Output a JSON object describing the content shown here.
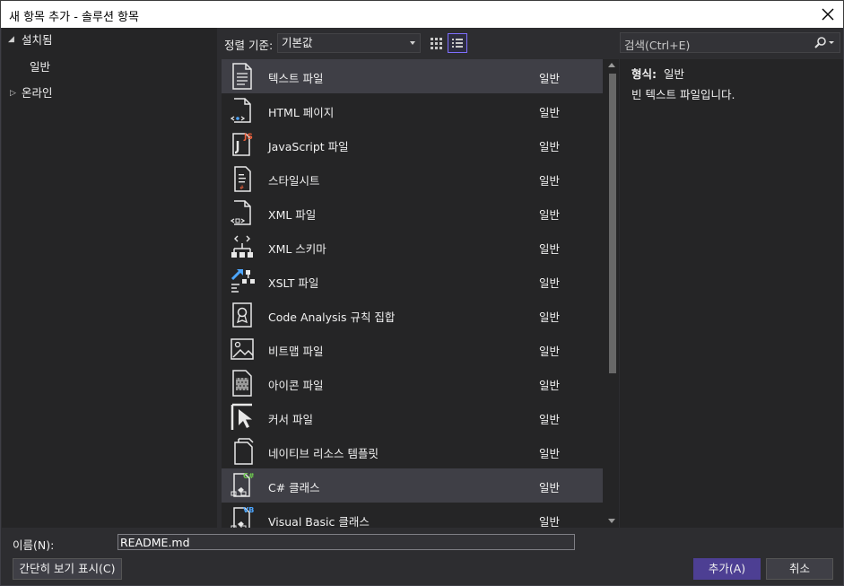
{
  "window": {
    "title": "새 항목 추가 - 솔루션 항목",
    "close_label": "×"
  },
  "tree": {
    "installed": {
      "label": "설치됨",
      "expanded": true
    },
    "general": {
      "label": "일반",
      "selected": true
    },
    "online": {
      "label": "온라인",
      "expanded": false
    }
  },
  "toolbar": {
    "sort_label": "정렬 기준:",
    "sort_value": "기본값",
    "view_mode": "list"
  },
  "search": {
    "placeholder": "검색(Ctrl+E)"
  },
  "templates": [
    {
      "name": "텍스트 파일",
      "category": "일반",
      "icon": "text-file-icon",
      "selected": true
    },
    {
      "name": "HTML 페이지",
      "category": "일반",
      "icon": "html-page-icon"
    },
    {
      "name": "JavaScript 파일",
      "category": "일반",
      "icon": "javascript-file-icon"
    },
    {
      "name": "스타일시트",
      "category": "일반",
      "icon": "stylesheet-icon"
    },
    {
      "name": "XML 파일",
      "category": "일반",
      "icon": "xml-file-icon"
    },
    {
      "name": "XML 스키마",
      "category": "일반",
      "icon": "xml-schema-icon"
    },
    {
      "name": "XSLT 파일",
      "category": "일반",
      "icon": "xslt-file-icon"
    },
    {
      "name": "Code Analysis 규칙 집합",
      "category": "일반",
      "icon": "ruleset-icon"
    },
    {
      "name": "비트맵 파일",
      "category": "일반",
      "icon": "bitmap-file-icon"
    },
    {
      "name": "아이콘 파일",
      "category": "일반",
      "icon": "icon-file-icon"
    },
    {
      "name": "커서 파일",
      "category": "일반",
      "icon": "cursor-file-icon"
    },
    {
      "name": "네이티브 리소스 템플릿",
      "category": "일반",
      "icon": "resource-template-icon"
    },
    {
      "name": "C# 클래스",
      "category": "일반",
      "icon": "csharp-class-icon",
      "highlighted": true
    },
    {
      "name": "Visual Basic 클래스",
      "category": "일반",
      "icon": "vb-class-icon"
    }
  ],
  "info": {
    "type_label": "형식:",
    "type_value": "일반",
    "description": "빈 텍스트 파일입니다."
  },
  "name_field": {
    "label": "이름(N):",
    "value": "README.md"
  },
  "buttons": {
    "compact_view": "간단히 보기 표시(C)",
    "add": "추가(A)",
    "cancel": "취소"
  },
  "colors": {
    "accent": "#4d3f93",
    "background": "#2d2d30",
    "panel": "#252526"
  }
}
